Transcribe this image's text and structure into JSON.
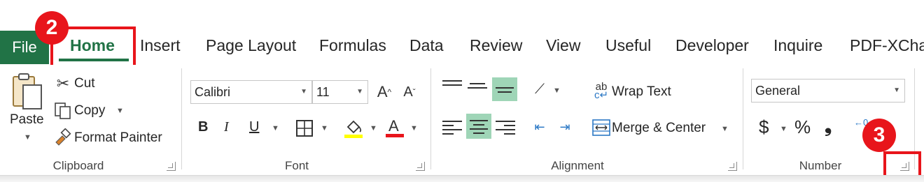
{
  "tabs": {
    "file": "File",
    "home": "Home",
    "insert": "Insert",
    "page_layout": "Page Layout",
    "formulas": "Formulas",
    "data": "Data",
    "review": "Review",
    "view": "View",
    "useful": "Useful",
    "developer": "Developer",
    "inquire": "Inquire",
    "pdf": "PDF-XCha"
  },
  "markers": {
    "step2": "2",
    "step3": "3"
  },
  "clipboard": {
    "paste": "Paste",
    "cut": "Cut",
    "copy": "Copy",
    "format_painter": "Format Painter",
    "label": "Clipboard"
  },
  "font": {
    "family": "Calibri",
    "size": "11",
    "bold": "B",
    "italic": "I",
    "underline": "U",
    "label": "Font"
  },
  "alignment": {
    "wrap_text": "Wrap Text",
    "merge_center": "Merge & Center",
    "label": "Alignment"
  },
  "number": {
    "format": "General",
    "currency": "$",
    "percent": "%",
    "comma": "❟",
    "label": "Number"
  },
  "colors": {
    "accent": "#217346",
    "highlight_bar": "#ffff00",
    "font_color_bar": "#e8151b",
    "annotation": "#e8151b",
    "selected_bg": "#9fd5b7"
  }
}
